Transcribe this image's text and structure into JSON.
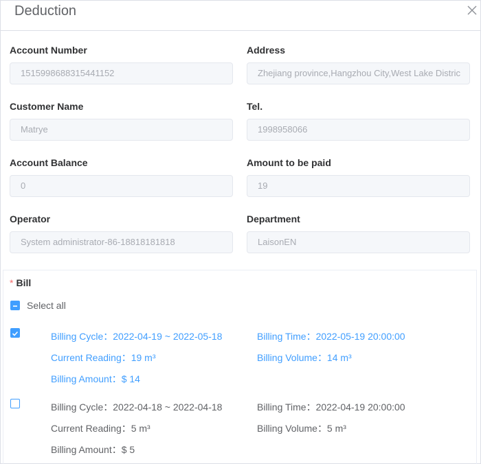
{
  "dialog": {
    "title": "Deduction"
  },
  "fields": {
    "account_number": {
      "label": "Account Number",
      "value": "1515998688315441152"
    },
    "address": {
      "label": "Address",
      "value": "Zhejiang province,Hangzhou City,West Lake Distric"
    },
    "customer_name": {
      "label": "Customer Name",
      "value": "Matrye"
    },
    "tel": {
      "label": "Tel.",
      "value": "1998958066"
    },
    "account_balance": {
      "label": "Account Balance",
      "value": "0"
    },
    "amount_to_be_paid": {
      "label": "Amount to be paid",
      "value": "19"
    },
    "operator": {
      "label": "Operator",
      "value": "System administrator-86-18818181818"
    },
    "department": {
      "label": "Department",
      "value": "LaisonEN"
    }
  },
  "bill": {
    "required_mark": "*",
    "label": "Bill",
    "select_all": {
      "label": "Select all",
      "state": "indeterminate"
    },
    "items": [
      {
        "checked": true,
        "billing_cycle": "Billing Cycle：2022-04-19 ~ 2022-05-18",
        "billing_time": "Billing Time：2022-05-19 20:00:00",
        "current_reading": "Current Reading：19 m³",
        "billing_volume": "Billing Volume：14 m³",
        "billing_amount": "Billing Amount：$ 14"
      },
      {
        "checked": false,
        "billing_cycle": "Billing Cycle：2022-04-18 ~ 2022-04-18",
        "billing_time": "Billing Time：2022-04-19 20:00:00",
        "current_reading": "Current Reading：5 m³",
        "billing_volume": "Billing Volume：5 m³",
        "billing_amount": "Billing Amount：$ 5"
      }
    ]
  },
  "colors": {
    "accent": "#409eff",
    "required": "#f56c6c"
  }
}
